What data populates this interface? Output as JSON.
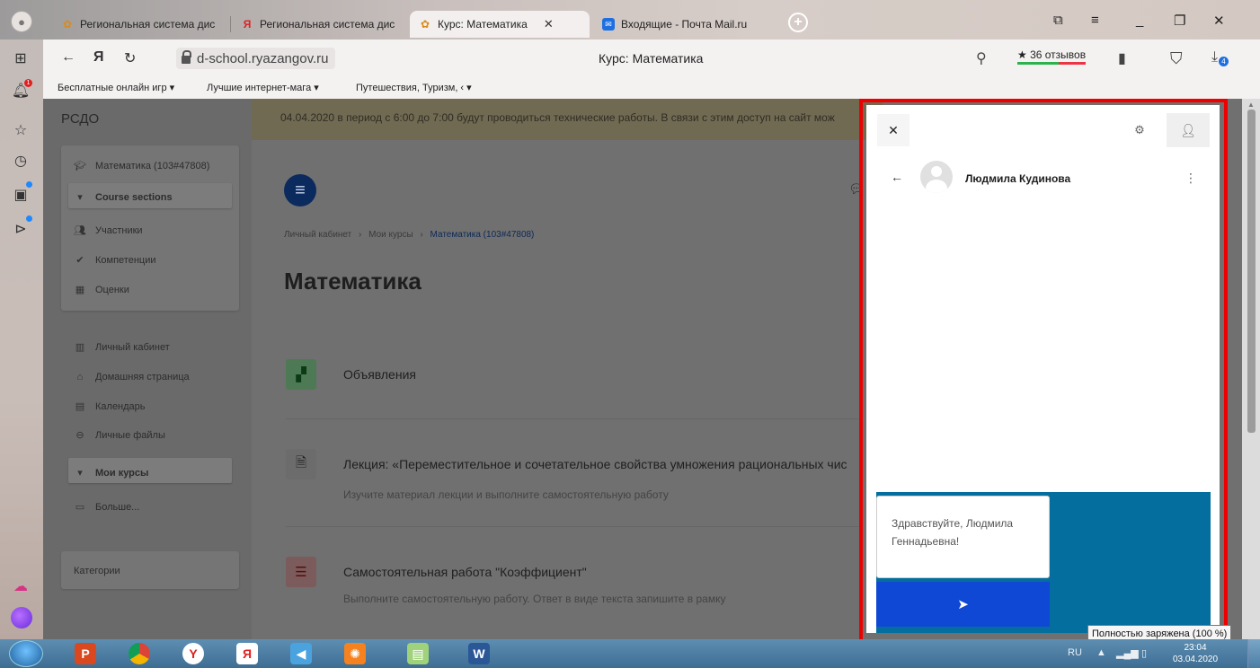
{
  "browser": {
    "tabs": [
      {
        "label": "Региональная система дис",
        "icon": "school-icon"
      },
      {
        "label": "Региональная система дис",
        "icon": "yandex-icon"
      },
      {
        "label": "Курс: Математика",
        "icon": "school-icon",
        "active": true
      },
      {
        "label": "Входящие - Почта Mail.ru",
        "icon": "mail-icon"
      }
    ],
    "url": "d-school.ryazangov.ru",
    "title": "Курс: Математика",
    "reviews": "★ 36 отзывов",
    "downloads_badge": "4",
    "bookmarks": [
      "Бесплатные онлайн игр ▾",
      "Лучшие интернет-мага ▾",
      "Путешествия, Туризм, ‹ ▾"
    ],
    "notifications_badge": "1"
  },
  "site": {
    "brand": "РСДО",
    "notice": "04.04.2020 в период с 6:00 до 7:00 будут проводиться технические работы. В связи с этим доступ на сайт мож",
    "nav_course": {
      "course": "Математика (103#47808)",
      "sections": "Course sections",
      "items": [
        "Участники",
        "Компетенции",
        "Оценки"
      ]
    },
    "nav_main": {
      "items": [
        "Личный кабинет",
        "Домашняя страница",
        "Календарь",
        "Личные файлы"
      ],
      "my_courses": "Мои курсы",
      "more": "Больше..."
    },
    "nav_categories": "Категории",
    "breadcrumb": {
      "a": "Личный кабинет",
      "b": "Мои курсы",
      "c": "Математика (103#47808)",
      "sep": "›"
    },
    "course_title": "Математика",
    "activities": [
      {
        "title": "Объявления",
        "desc": ""
      },
      {
        "title": "Лекция: «Переместительное и сочетательное свойства умножения рациональных чис",
        "desc": "Изучите материал лекции и выполните самостоятельную работу"
      },
      {
        "title": "Самостоятельная работа \"Коэффициент\"",
        "desc": "Выполните самостоятельную работу. Ответ в виде текста запишите в рамку"
      }
    ]
  },
  "chat": {
    "contact_name": "Людмила Кудинова",
    "message_draft": "Здравствуйте, Людмила Геннадьевна!"
  },
  "system": {
    "battery_tooltip": "Полностью заряжена (100 %)",
    "lang": "RU",
    "time": "23:04",
    "date": "03.04.2020"
  }
}
